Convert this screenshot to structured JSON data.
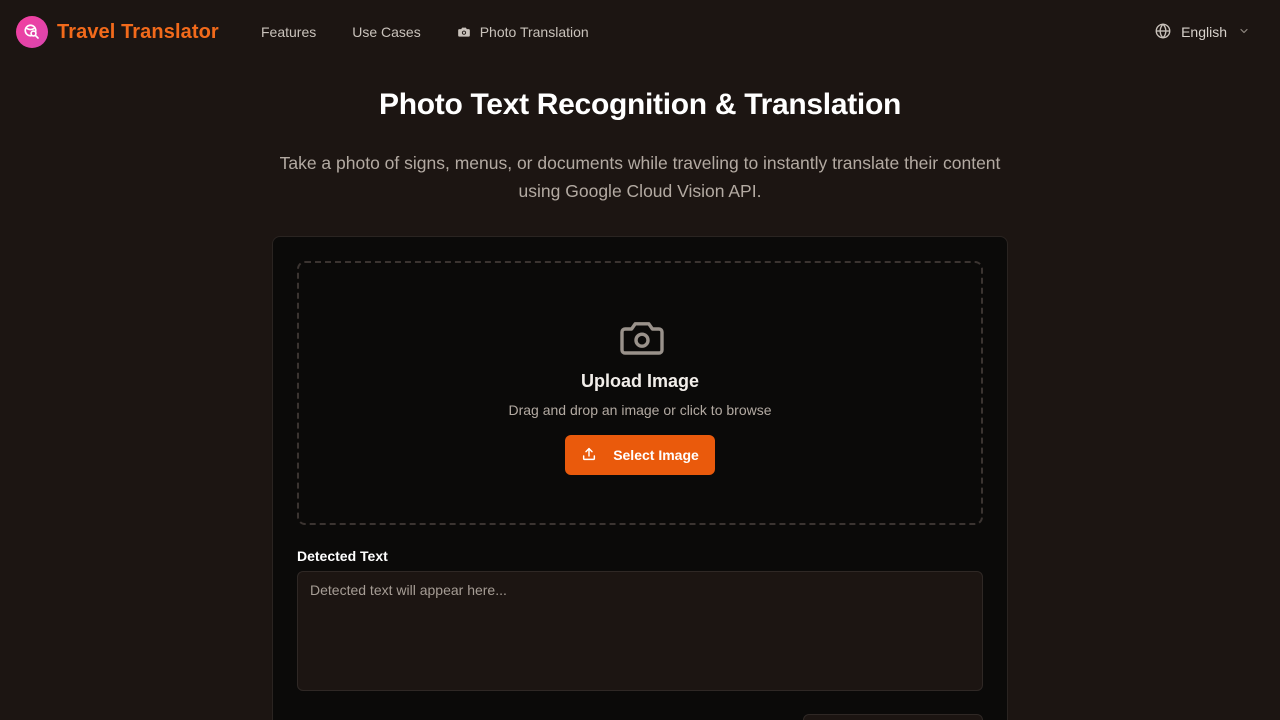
{
  "header": {
    "brand": "Travel Translator",
    "nav": {
      "features": "Features",
      "use_cases": "Use Cases",
      "photo_translation": "Photo Translation"
    },
    "language": "English"
  },
  "hero": {
    "title": "Photo Text Recognition & Translation",
    "subtitle": "Take a photo of signs, menus, or documents while traveling to instantly translate their content using Google Cloud Vision API."
  },
  "upload": {
    "title": "Upload Image",
    "hint": "Drag and drop an image or click to browse",
    "button_label": "Select Image"
  },
  "detected": {
    "label": "Detected Text",
    "placeholder": "Detected text will appear here...",
    "value": ""
  },
  "icons": {
    "logo": "search-globe-icon",
    "photo_nav": "camera-icon",
    "language": "globe-icon",
    "language_caret": "chevron-down-icon",
    "upload_area": "camera-icon",
    "select_button": "upload-icon"
  },
  "colors": {
    "background": "#1c1512",
    "accent": "#ea5a0c",
    "brand_text": "#f26a1b",
    "logo_badge": "#e040a8",
    "card": "#0b0a09"
  }
}
